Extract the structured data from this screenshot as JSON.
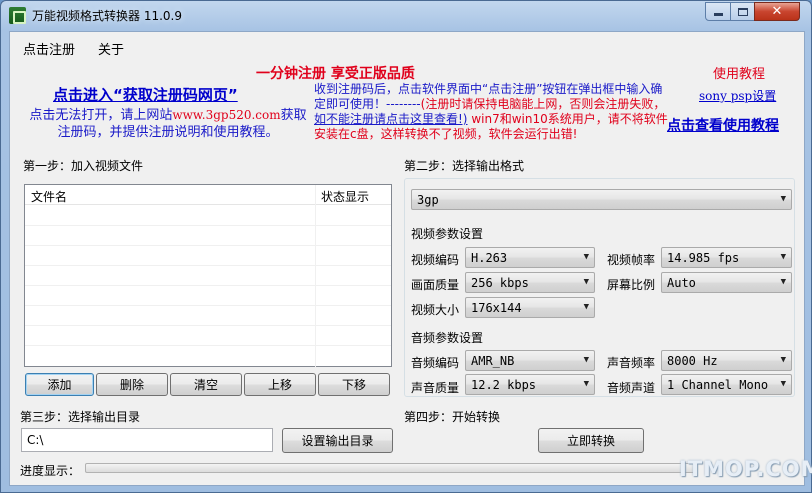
{
  "window": {
    "title": "万能视频格式转换器 11.0.9"
  },
  "menu": [
    "点击注册",
    "关于"
  ],
  "promo": {
    "title": "一分钟注册 享受正版品质",
    "register_link": "点击进入“获取注册码网页”",
    "hint_line1_prefix": "点击无法打开，请上网站",
    "hint_site": "www.3gp520.com",
    "hint_line1_suffix": "获取",
    "hint_line2": "注册码，并提供注册说明和使用教程。",
    "info_part1": "收到注册码后，点击软件界面中“点击注册”按钮在弹出框中输入确定即可使用！--------",
    "info_part2": "(注册时请保持电脑能上网，否则会注册失败，",
    "info_part3": "如不能注册请点击这里查看!)",
    "info_part4": " win7和win10系统用户，请不将软件安装在c盘，这样转换不了视频，软件会运行出错!",
    "tutorial_title": "使用教程",
    "psp_link": "sony psp设置",
    "tutorial_link": "点击查看使用教程"
  },
  "step1": {
    "label": "第一步：加入视频文件",
    "columns": [
      "文件名",
      "状态显示"
    ],
    "buttons": [
      "添加",
      "删除",
      "清空",
      "上移",
      "下移"
    ]
  },
  "step2": {
    "label": "第二步：选择输出格式",
    "format": "3gp",
    "video_section": "视频参数设置",
    "video_codec_label": "视频编码",
    "video_codec": "H.263",
    "frame_rate_label": "视频帧率",
    "frame_rate": "14.985 fps",
    "quality_label": "画面质量",
    "quality": "256 kbps",
    "aspect_label": "屏幕比例",
    "aspect": "Auto",
    "size_label": "视频大小",
    "size": "176x144",
    "audio_section": "音频参数设置",
    "audio_codec_label": "音频编码",
    "audio_codec": "AMR_NB",
    "sample_rate_label": "声音频率",
    "sample_rate": "8000 Hz",
    "audio_quality_label": "声音质量",
    "audio_quality": "12.2 kbps",
    "channels_label": "音频声道",
    "channels": "1 Channel Mono"
  },
  "step3": {
    "label": "第三步：选择输出目录",
    "path": "C:\\",
    "button": "设置输出目录"
  },
  "step4": {
    "label": "第四步：开始转换",
    "button": "立即转换"
  },
  "progress": {
    "label": "进度显示：",
    "value": 0
  },
  "watermark": "ITMOP.COM"
}
